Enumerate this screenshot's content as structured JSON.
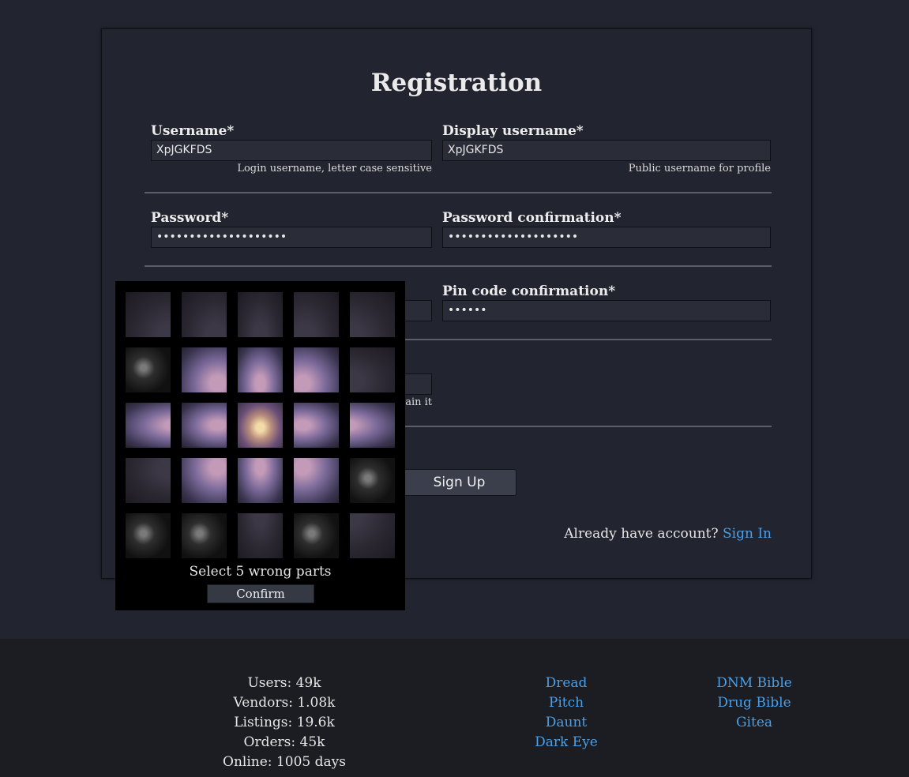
{
  "form": {
    "title": "Registration",
    "username_label": "Username*",
    "username_value": "XpJGKFDS",
    "username_hint": "Login username, letter case sensitive",
    "display_label": "Display username*",
    "display_value": "XpJGKFDS",
    "display_hint": "Public username for profile",
    "password_label": "Password*",
    "password_value": "••••••••••••••••••••",
    "password_confirm_label": "Password confirmation*",
    "password_confirm_value": "••••••••••••••••••••",
    "pin_confirm_label": "Pin code confirmation*",
    "pin_confirm_value": "••••••",
    "partial_hint": "ain it",
    "signup_label": "Sign Up",
    "already_text": "Already have account?",
    "signin_link": "Sign In"
  },
  "captcha": {
    "instruction": "Select 5 wrong parts",
    "confirm_label": "Confirm"
  },
  "footer": {
    "stats": [
      "Users: 49k",
      "Vendors: 1.08k",
      "Listings: 19.6k",
      "Orders: 45k",
      "Online: 1005 days"
    ],
    "links_a": [
      "Dread",
      "Pitch",
      "Daunt",
      "Dark Eye"
    ],
    "links_b": [
      "DNM Bible",
      "Drug Bible",
      "Gitea"
    ]
  },
  "colors": {
    "background": "#22252f",
    "footer_bg": "#1b1d22",
    "link": "#4c9fe6"
  }
}
